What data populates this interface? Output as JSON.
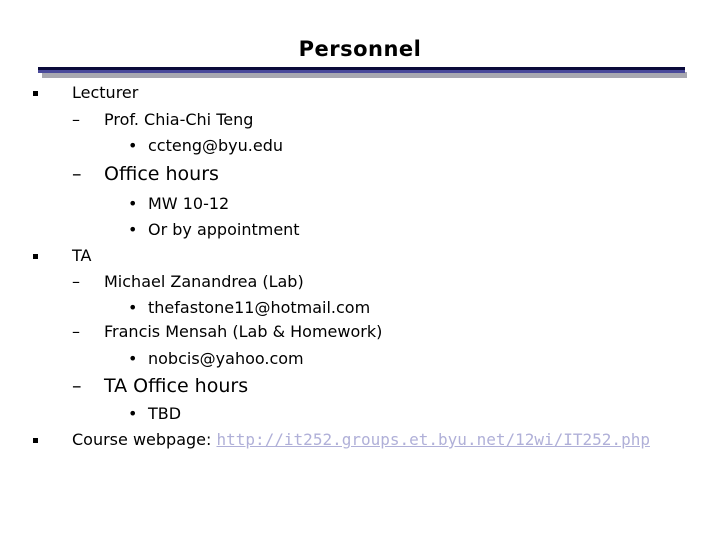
{
  "slide": {
    "title": "Personnel",
    "bullets": {
      "lecturer": "Lecturer",
      "lecturer_name": "Prof. Chia-Chi Teng",
      "lecturer_email": "ccteng@byu.edu",
      "office_hours": "Office hours",
      "office_hours_1": "MW 10-12",
      "office_hours_2": "Or by appointment",
      "ta": "TA",
      "ta1_name": "Michael Zanandrea (Lab)",
      "ta1_email": "thefastone11@hotmail.com",
      "ta2_name": "Francis Mensah (Lab & Homework)",
      "ta2_email": "nobcis@yahoo.com",
      "ta_office_hours": "TA Office hours",
      "ta_office_hours_1": "TBD",
      "webpage_label": "Course webpage:",
      "webpage_url": "http://it252.groups.et.byu.net/12wi/IT252.php"
    },
    "glyphs": {
      "dash": "–",
      "dot": "•"
    },
    "colors": {
      "rule_dark": "#0a0a3a",
      "rule_blue": "#4a4a9a",
      "link": "#b0b0d8"
    }
  }
}
